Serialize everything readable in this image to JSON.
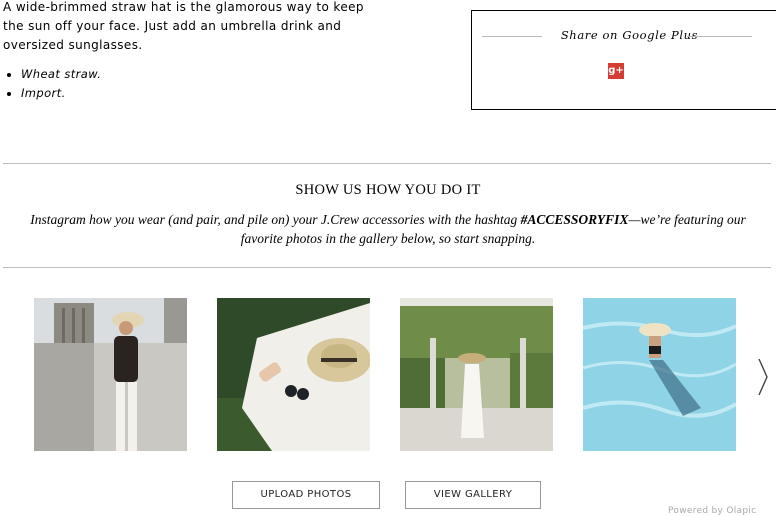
{
  "product": {
    "description": "A wide-brimmed straw hat is the glamorous way to keep the sun off your face. Just add an umbrella drink and oversized sunglasses.",
    "bullets": [
      "Wheat straw.",
      "Import."
    ]
  },
  "share": {
    "title": "Share on Google Plus",
    "icon": "google-plus-icon",
    "icon_text": "g+",
    "icon_color": "#d73d32"
  },
  "gallery": {
    "heading": "SHOW US HOW YOU DO IT",
    "text_before": "Instagram how you wear (and pair, and pile on) your J.Crew accessories with the hashtag ",
    "hashtag": "#ACCESSORYFIX",
    "text_after": "—we’re featuring our favorite photos in the gallery below, so start snapping.",
    "photos": [
      {
        "name": "woman-in-city-photo"
      },
      {
        "name": "hat-on-blanket-photo"
      },
      {
        "name": "woman-under-pergola-photo"
      },
      {
        "name": "woman-in-pool-photo"
      }
    ],
    "upload_label": "UPLOAD PHOTOS",
    "view_label": "VIEW GALLERY",
    "powered_by": "Powered by Olapic"
  }
}
